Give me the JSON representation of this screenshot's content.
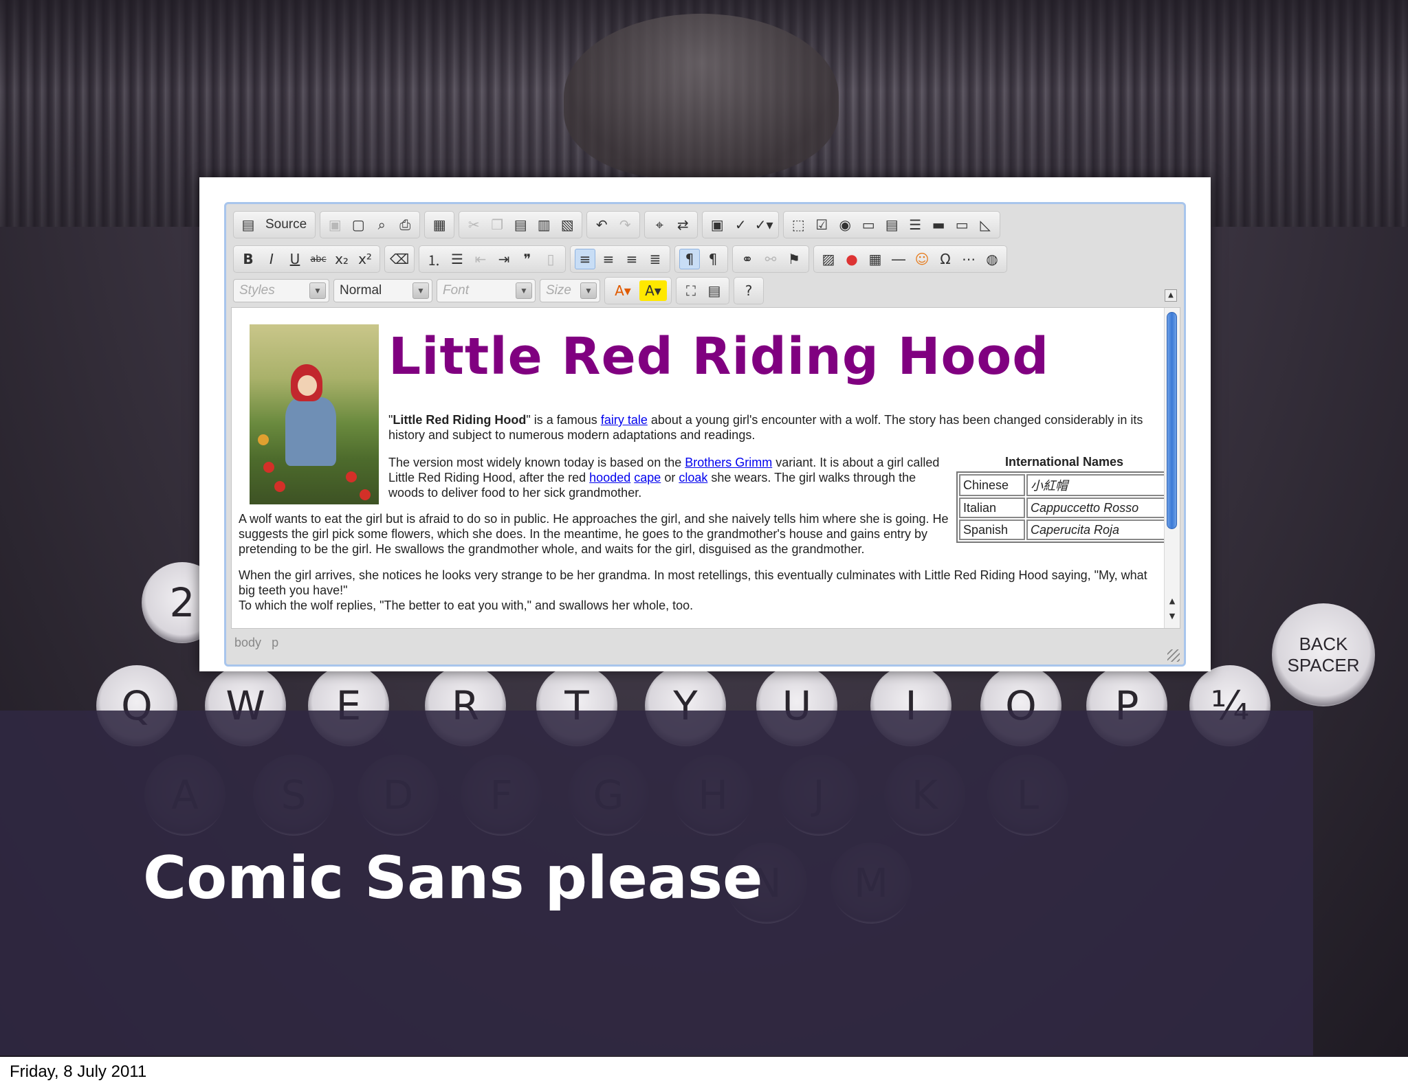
{
  "slide": {
    "caption": "Comic Sans please",
    "footer_date": "Friday, 8 July 2011"
  },
  "keys": {
    "row_top": [
      "\"",
      "2"
    ],
    "row_qwerty": [
      "Q",
      "W",
      "E",
      "R",
      "T",
      "Y",
      "U",
      "I",
      "O",
      "P",
      "¼"
    ],
    "row_asdf": [
      "A",
      "S",
      "D",
      "F",
      "G",
      "H",
      "J",
      "K",
      "L"
    ],
    "row_zx": [
      "N",
      "M"
    ],
    "backspace": [
      "BACK",
      "SPACER"
    ]
  },
  "editor": {
    "toolbar": {
      "source_label": "Source",
      "styles_placeholder": "Styles",
      "format_value": "Normal",
      "font_placeholder": "Font",
      "size_placeholder": "Size"
    },
    "content": {
      "title": "Little Red Riding Hood",
      "p1": {
        "bold": "Little Red Riding Hood",
        "t1": " is a famous ",
        "link1": "fairy tale",
        "t2": " about a young girl's encounter with a wolf. The story has been changed considerably in its history and subject to numerous modern adaptations and readings."
      },
      "p2": {
        "t1": "The version most widely known today is based on the ",
        "link1": "Brothers Grimm",
        "t2": " variant. It is about a girl called Little Red Riding Hood, after the red ",
        "link2": "hooded",
        "link3": "cape",
        "t3": " or ",
        "link4": "cloak",
        "t4": " she wears. The girl walks through the woods to deliver food to her sick grandmother."
      },
      "p3": "A wolf wants to eat the girl but is afraid to do so in public. He approaches the girl, and she naively tells him where she is going. He suggests the girl pick some flowers, which she does. In the meantime, he goes to the grandmother's house and gains entry by pretending to be the girl. He swallows the grandmother whole, and waits for the girl, disguised as the grandmother.",
      "p4_line1": "When the girl arrives, she notices he looks very strange to be her grandma. In most retellings, this eventually culminates with Little Red Riding Hood saying, \"My, what big teeth you have!\"",
      "p4_line2": "To which the wolf replies, \"The better to eat you with,\" and swallows her whole, too.",
      "names_table": {
        "caption": "International Names",
        "rows": [
          {
            "language": "Chinese",
            "name": "小紅帽"
          },
          {
            "language": "Italian",
            "name": "Cappuccetto Rosso"
          },
          {
            "language": "Spanish",
            "name": "Caperucita Roja"
          }
        ]
      }
    },
    "status": {
      "path1": "body",
      "path2": "p"
    }
  }
}
